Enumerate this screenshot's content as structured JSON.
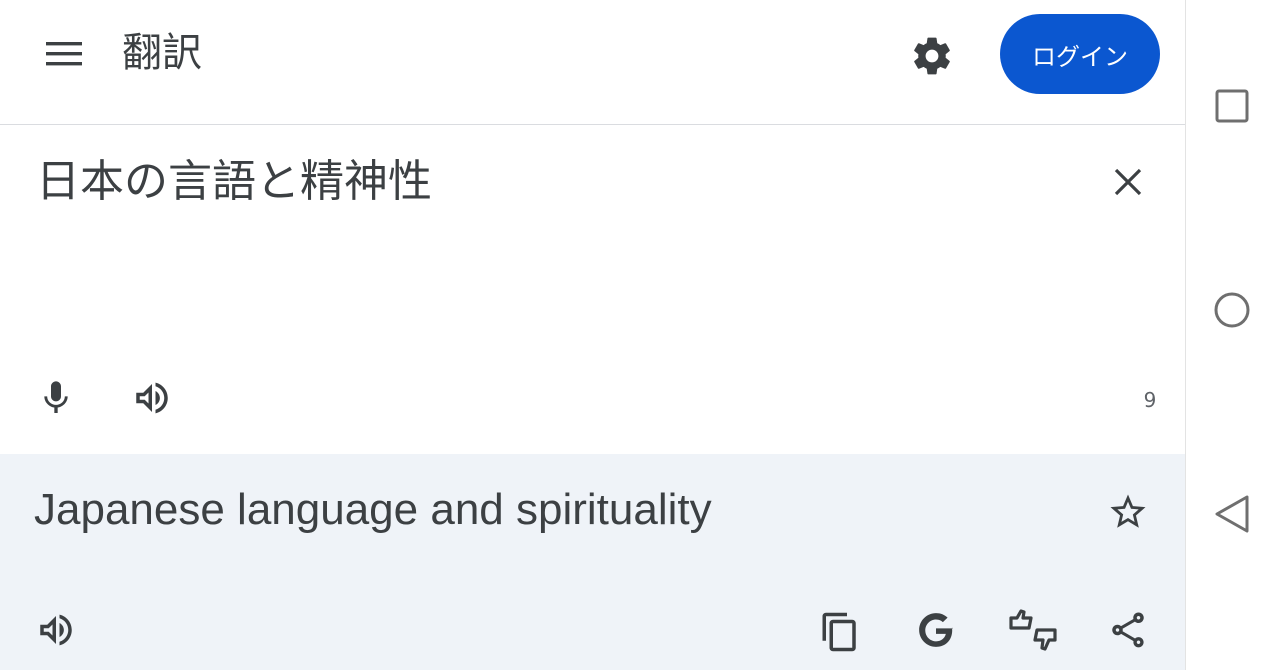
{
  "header": {
    "title": "翻訳",
    "login_label": "ログイン"
  },
  "source": {
    "text": "日本の言語と精神性",
    "char_count": "9"
  },
  "result": {
    "text": "Japanese language and spirituality"
  },
  "colors": {
    "accent": "#0b57d0",
    "result_bg": "#eff3f8",
    "text": "#3c4043",
    "icon": "#5f6368"
  },
  "icons": {
    "menu": "menu-icon",
    "settings": "gear-icon",
    "clear": "close-icon",
    "mic": "microphone-icon",
    "speaker": "speaker-icon",
    "star": "star-icon",
    "copy": "copy-icon",
    "google": "google-icon",
    "feedback": "feedback-icon",
    "share": "share-icon",
    "recents": "square-icon",
    "home": "circle-icon",
    "back": "back-triangle-icon"
  }
}
